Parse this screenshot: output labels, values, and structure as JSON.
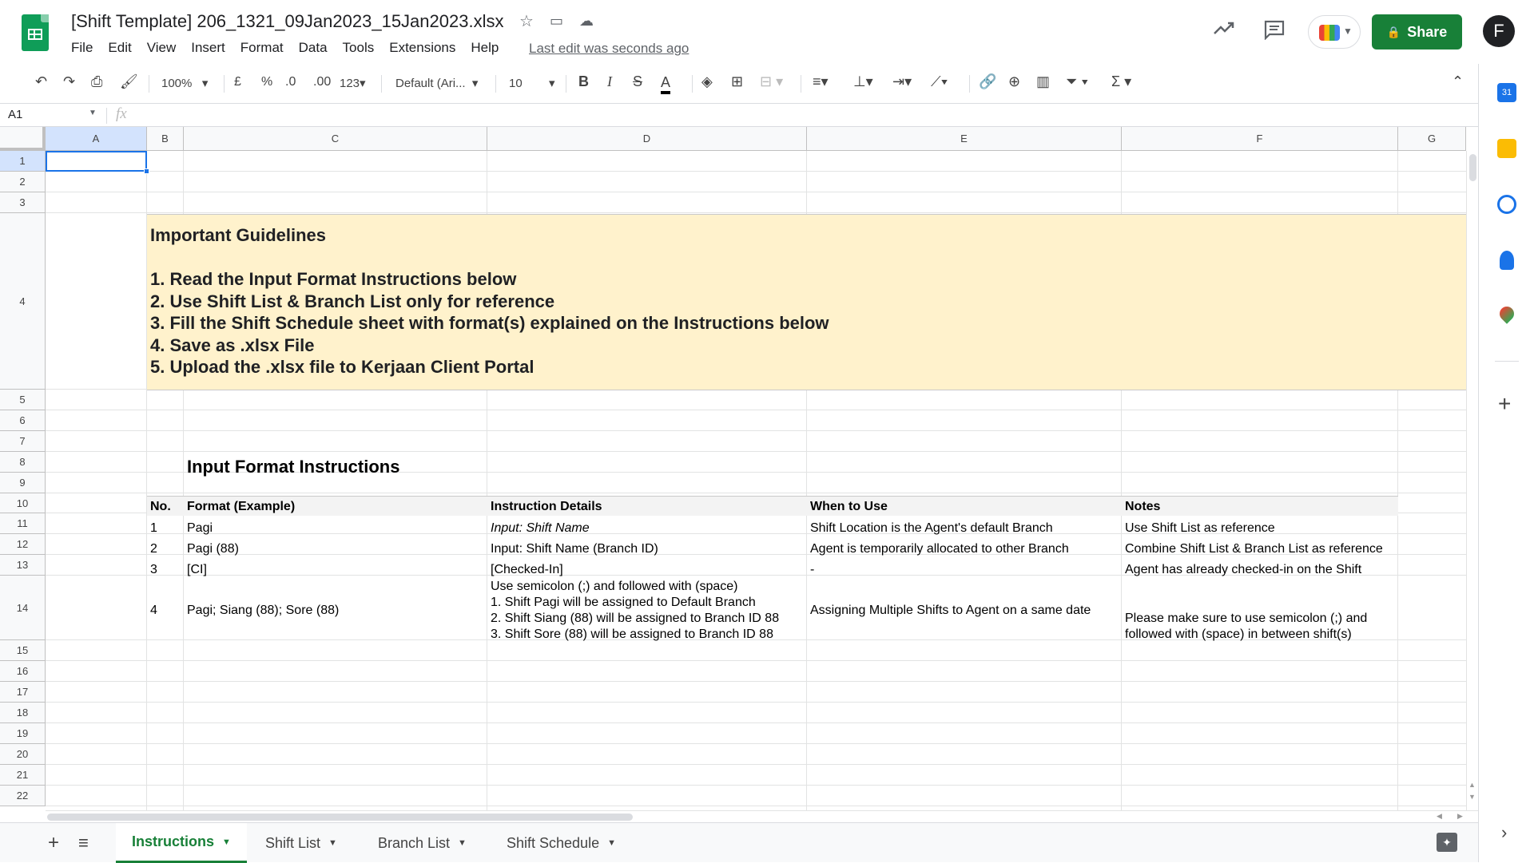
{
  "document": {
    "title": "[Shift Template] 206_1321_09Jan2023_15Jan2023.xlsx",
    "last_edit": "Last edit was seconds ago"
  },
  "menu": [
    "File",
    "Edit",
    "View",
    "Insert",
    "Format",
    "Data",
    "Tools",
    "Extensions",
    "Help"
  ],
  "header": {
    "share_label": "Share",
    "avatar_initial": "F"
  },
  "toolbar": {
    "zoom": "100%",
    "currency": "£",
    "percent": "%",
    "dec_decrease": ".0",
    "dec_increase": ".00",
    "more_formats": "123",
    "font": "Default (Ari...",
    "font_size": "10"
  },
  "formula_bar": {
    "cell_ref": "A1",
    "fx": "fx"
  },
  "columns": [
    "A",
    "B",
    "C",
    "D",
    "E",
    "F",
    "G"
  ],
  "rows": [
    "1",
    "2",
    "3",
    "4",
    "5",
    "6",
    "7",
    "8",
    "9",
    "10",
    "11",
    "12",
    "13",
    "14",
    "15",
    "16",
    "17",
    "18",
    "19",
    "20",
    "21",
    "22"
  ],
  "guidelines": {
    "title": "Important Guidelines",
    "items": [
      "1. Read the Input Format Instructions below",
      "2. Use Shift List & Branch List only for reference",
      "3. Fill the Shift Schedule sheet with format(s) explained on the Instructions below",
      "4. Save as .xlsx File",
      "5. Upload the .xlsx file to Kerjaan Client Portal"
    ]
  },
  "instructions": {
    "title": "Input Format Instructions",
    "headers": [
      "No.",
      "Format (Example)",
      "Instruction Details",
      "When to Use",
      "Notes"
    ],
    "rows": [
      {
        "no": "1",
        "format": "Pagi",
        "details": "Input: Shift Name",
        "when": "Shift Location is the Agent's default Branch",
        "notes": "Use Shift List as reference"
      },
      {
        "no": "2",
        "format": "Pagi (88)",
        "details": "Input: Shift Name (Branch ID)",
        "when": "Agent is temporarily allocated to other Branch",
        "notes": "Combine Shift List & Branch List as reference"
      },
      {
        "no": "3",
        "format": "[CI]",
        "details": "[Checked-In]",
        "when": "-",
        "notes": "Agent has already checked-in on the Shift"
      },
      {
        "no": "4",
        "format": "Pagi; Siang (88); Sore (88)",
        "details_lines": [
          "Use semicolon (;) and followed with (space)",
          "1. Shift Pagi will be assigned to Default Branch",
          "2. Shift Siang (88) will be assigned to Branch ID 88",
          "3. Shift Sore (88) will be assigned to Branch ID 88"
        ],
        "when": "Assigning Multiple Shifts to Agent on a same date",
        "notes_lines": [
          "Please make sure to use semicolon (;) and",
          "followed with (space) in between shift(s)"
        ]
      }
    ]
  },
  "sheets": [
    {
      "label": "Instructions",
      "active": true
    },
    {
      "label": "Shift List",
      "active": false
    },
    {
      "label": "Branch List",
      "active": false
    },
    {
      "label": "Shift Schedule",
      "active": false
    }
  ],
  "colors": {
    "brand_green": "#188038",
    "guideline_bg": "#fff2cc",
    "header_row_bg": "#f3f3f3",
    "selection": "#1a73e8"
  }
}
